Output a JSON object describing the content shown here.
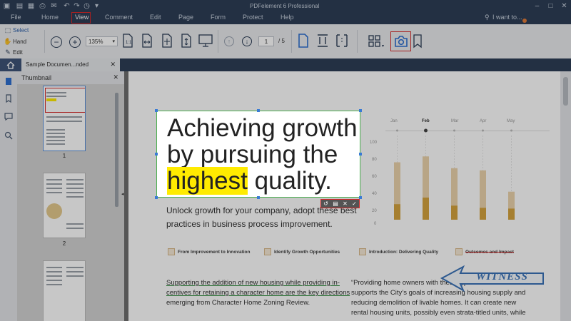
{
  "window": {
    "title": "PDFelement 6 Professional"
  },
  "menu": {
    "items": [
      "File",
      "Home",
      "View",
      "Comment",
      "Edit",
      "Page",
      "Form",
      "Protect",
      "Help"
    ],
    "search_placeholder": "I want to..."
  },
  "ribbon": {
    "modes": [
      "Select",
      "Hand",
      "Edit"
    ],
    "zoom": "135%",
    "page_current": "1",
    "page_total": "/ 5"
  },
  "tabs": {
    "document": "Sample Documen...nded"
  },
  "thumbnails": {
    "header": "Thumbnail",
    "pages": [
      "1",
      "2"
    ]
  },
  "document": {
    "heading": [
      "Achieving growth",
      "by pursuing the"
    ],
    "heading_line3_highlight": "highest",
    "heading_line3_rest": " quality.",
    "intro": [
      "Unlock growth for your company, adopt these best",
      "practices in business process improvement."
    ],
    "features": [
      "From Improvement to Innovation",
      "Identify Growth Opportunities",
      "Introduction: Delivering Quality",
      "Outcomes and Impact"
    ],
    "left_paragraph": [
      "Supporting the addition of new housing while providing in-",
      "centives for retaining a character home are the key directions",
      "emerging from Character Home Zoning Review."
    ],
    "right_paragraph": [
      "“Providing home owners with these types of incentives",
      "supports the City’s goals of increasing housing supply and",
      "reducing demolition of livable homes.  It can create new",
      "rental housing units, possibly even strata-titled units, while"
    ],
    "stamp": "WITNESS"
  },
  "chart_data": {
    "type": "bar",
    "categories": [
      "Jan",
      "Feb",
      "Mar",
      "Apr",
      "May"
    ],
    "series": [
      {
        "values": [
          83,
          91,
          75,
          72,
          43
        ]
      },
      {
        "values": [
          26,
          35,
          24,
          21,
          20
        ]
      }
    ],
    "yticks": [
      "100",
      "80",
      "60",
      "40",
      "20",
      "0"
    ],
    "ylim": [
      0,
      100
    ]
  },
  "colors": {
    "chrome": "#2d3e57",
    "accent_red": "#d62b2b",
    "highlight": "#ffeb00",
    "bar_light": "#ecd4ac",
    "bar_dark": "#d5a33e"
  }
}
